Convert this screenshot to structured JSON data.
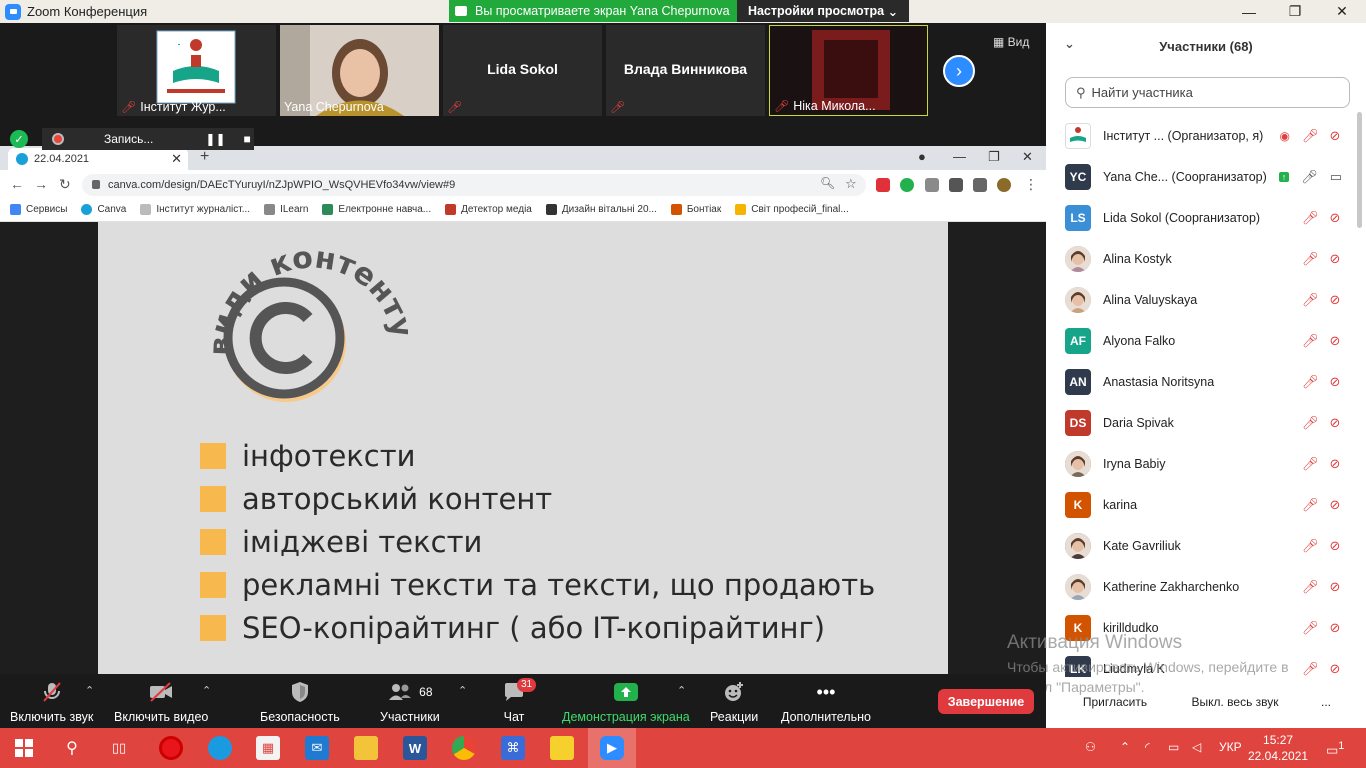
{
  "window": {
    "title": "Zoom Конференция",
    "share_banner": "Вы просматриваете экран Yana Chepurnova",
    "view_settings": "Настройки просмотра"
  },
  "video_tiles": [
    {
      "name": "Інститут Жур...",
      "muted": true
    },
    {
      "name": "Yana Chepurnova",
      "muted": false
    },
    {
      "name": "Lida Sokol",
      "muted": true
    },
    {
      "name": "Влада Винникова",
      "muted": true
    },
    {
      "name": "Ніка Микола...",
      "muted": true
    }
  ],
  "view_label": "Вид",
  "recording": {
    "label": "Запись..."
  },
  "browser": {
    "tab_title": "22.04.2021",
    "url": "canva.com/design/DAEcTYuruyI/nZJpWPIO_WsQVHEVfo34vw/view#9",
    "bookmarks": [
      {
        "label": "Сервисы",
        "color": "#4285f4"
      },
      {
        "label": "Canva",
        "color": "#1aa0d8"
      },
      {
        "label": "Інститут журналіст...",
        "color": "#999999"
      },
      {
        "label": "ILearn",
        "color": "#666666"
      },
      {
        "label": "Електронне навча...",
        "color": "#2e8b57"
      },
      {
        "label": "Детектор медіа",
        "color": "#c0392b"
      },
      {
        "label": "Дизайн вітальні 20...",
        "color": "#333333"
      },
      {
        "label": "Бонтіак",
        "color": "#d35400"
      },
      {
        "label": "Світ професій_final...",
        "color": "#f4b400"
      }
    ]
  },
  "slide": {
    "logo_text": "види контенту",
    "bullets": [
      "інфотексти",
      "авторський контент",
      "іміджеві тексти",
      "рекламні тексти та тексти, що продають",
      "SEO-копірайтинг ( або IT-копірайтинг)"
    ],
    "bullet_color": "#f7b94d"
  },
  "participants_panel": {
    "title": "Участники (68)",
    "search_placeholder": "Найти участника",
    "participants": [
      {
        "name": "Інститут ...  (Организатор, я)",
        "initials": "",
        "color": "#ffffff",
        "status": "host"
      },
      {
        "name": "Yana Che...  (Соорганизатор)",
        "initials": "YC",
        "color": "#2f3b4c",
        "status": "sharing"
      },
      {
        "name": "Lida Sokol (Соорганизатор)",
        "initials": "LS",
        "color": "#3a8fd6",
        "status": "muted"
      },
      {
        "name": "Alina Kostyk",
        "initials": "",
        "color": "#b08a9a",
        "status": "muted"
      },
      {
        "name": "Alina Valuyskaya",
        "initials": "",
        "color": "#c9a27c",
        "status": "muted"
      },
      {
        "name": "Alyona Falko",
        "initials": "AF",
        "color": "#17a589",
        "status": "muted"
      },
      {
        "name": "Anastasia Noritsyna",
        "initials": "AN",
        "color": "#2f3b4c",
        "status": "muted"
      },
      {
        "name": "Daria Spivak",
        "initials": "DS",
        "color": "#c0392b",
        "status": "muted"
      },
      {
        "name": "Iryna Babiy",
        "initials": "",
        "color": "#7a6a5a",
        "status": "muted"
      },
      {
        "name": "karina",
        "initials": "K",
        "color": "#d35400",
        "status": "muted"
      },
      {
        "name": "Kate Gavriliuk",
        "initials": "",
        "color": "#4a3b3b",
        "status": "muted"
      },
      {
        "name": "Katherine Zakharchenko",
        "initials": "",
        "color": "#9aa7b8",
        "status": "muted"
      },
      {
        "name": "kirilldudko",
        "initials": "K",
        "color": "#d35400",
        "status": "muted"
      },
      {
        "name": "Liudmyla K",
        "initials": "LK",
        "color": "#2f3b4c",
        "status": "muted"
      }
    ],
    "invite": "Пригласить",
    "mute_all": "Выкл. весь звук",
    "more": "..."
  },
  "watermark": {
    "line1": "Активация Windows",
    "line2": "Чтобы активировать Windows, перейдите в раздел \"Параметры\"."
  },
  "toolbar": {
    "audio": "Включить звук",
    "video": "Включить видео",
    "security": "Безопасность",
    "participants": "Участники",
    "participants_count": "68",
    "chat": "Чат",
    "chat_badge": "31",
    "share": "Демонстрация экрана",
    "reactions": "Реакции",
    "more": "Дополнительно",
    "end": "Завершение"
  },
  "taskbar": {
    "lang": "УКР",
    "time": "15:27",
    "date": "22.04.2021",
    "notif": "1"
  }
}
